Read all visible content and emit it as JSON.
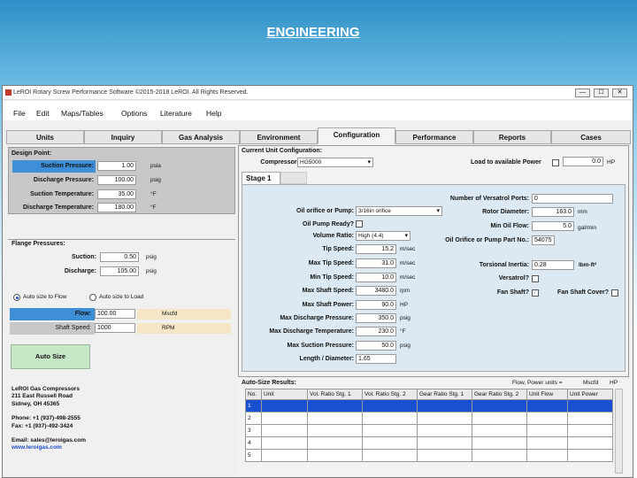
{
  "slide": {
    "title": "ENGINEERING"
  },
  "window": {
    "title": "LeROI Rotary Screw Performance Software ©2015-2018 LeROI. All Rights Reserved.",
    "minimize": "—",
    "maximize": "☐",
    "close": "✕"
  },
  "menu": [
    "File",
    "Edit",
    "Maps/Tables",
    "Options",
    "Literature",
    "Help"
  ],
  "tabs": [
    "Units",
    "Inquiry",
    "Gas Analysis",
    "Environment",
    "Configuration",
    "Performance",
    "Reports",
    "Cases"
  ],
  "active_tab": "Configuration",
  "design_point": {
    "title": "Design Point:",
    "rows": [
      {
        "label": "Suction Pressure:",
        "value": "1.00",
        "unit": "psia"
      },
      {
        "label": "Discharge Pressure:",
        "value": "100.00",
        "unit": "psig"
      },
      {
        "label": "Suction Temperature:",
        "value": "35.00",
        "unit": "°F"
      },
      {
        "label": "Discharge Temperature:",
        "value": "180.00",
        "unit": "°F"
      }
    ]
  },
  "flange": {
    "title": "Flange Pressures:",
    "rows": [
      {
        "label": "Suction:",
        "value": "0.50",
        "unit": "psig"
      },
      {
        "label": "Discharge:",
        "value": "105.00",
        "unit": "psig"
      }
    ]
  },
  "autosize": {
    "radio1": "Auto size to Flow",
    "radio2": "Auto size to Load",
    "flow_label": "Flow:",
    "flow_value": "100.00",
    "flow_unit": "Mscfd",
    "speed_label": "Shaft Speed:",
    "speed_value": "1000",
    "speed_unit": "RPM",
    "button": "Auto Size"
  },
  "company": {
    "lines": [
      "LeROI Gas Compressors",
      "211 East Russell Road",
      "Sidney, OH 45365",
      "",
      "Phone: +1 (937)-498-2555",
      "Fax: +1 (937)-492-3424",
      "",
      "Email: sales@leroigas.com",
      "www.leroigas.com"
    ]
  },
  "current_config": {
    "title": "Current Unit Configuration:",
    "compressor_label": "Compressor:",
    "compressor_value": "HG5000",
    "load_label": "Load to available Power",
    "power_value": "0.0",
    "power_unit": "HP"
  },
  "stage": {
    "tab": "Stage 1",
    "left": [
      {
        "label": "Oil orifice or Pump:",
        "value": "3/16in orifice",
        "type": "select"
      },
      {
        "label": "Oil Pump Ready?",
        "type": "check"
      },
      {
        "label": "Volume Ratio:",
        "value": "High (4.4)",
        "type": "select"
      },
      {
        "label": "Tip Speed:",
        "value": "15.2",
        "unit": "m/sec"
      },
      {
        "label": "Max Tip Speed:",
        "value": "31.0",
        "unit": "m/sec"
      },
      {
        "label": "Min Tip Speed:",
        "value": "10.0",
        "unit": "m/sec"
      },
      {
        "label": "Max Shaft Speed:",
        "value": "3480.0",
        "unit": "rpm"
      },
      {
        "label": "Max Shaft Power:",
        "value": "90.0",
        "unit": "HP"
      },
      {
        "label": "Max Discharge Pressure:",
        "value": "350.0",
        "unit": "psig"
      },
      {
        "label": "Max Discharge Temperature:",
        "value": "230.0",
        "unit": "°F"
      },
      {
        "label": "Max Suction Pressure:",
        "value": "50.0",
        "unit": "psig"
      },
      {
        "label": "Length / Diameter:",
        "value": "1.65",
        "unit": ""
      }
    ],
    "right": [
      {
        "label": "Number of Versatrol Ports:",
        "value": "0",
        "unit": ""
      },
      {
        "label": "Rotor Diameter:",
        "value": "163.0",
        "unit": "mm"
      },
      {
        "label": "Min Oil Flow:",
        "value": "5.0",
        "unit": "gal/min"
      },
      {
        "label": "Oil Orifice or Pump Part No.:",
        "value": "54075",
        "unit": ""
      },
      {
        "label": "Torsional Inertia:",
        "value": "0.28",
        "unit": "lbm-ft²"
      },
      {
        "label": "Versatrol?",
        "value": "",
        "unit": ""
      }
    ],
    "fan_shaft_label": "Fan Shaft?",
    "fan_cover_label": "Fan Shaft Cover?"
  },
  "results": {
    "title": "Auto-Size Results:",
    "units_note": "Flow, Power units =",
    "units_flow": "Mscfd",
    "units_power": "HP",
    "columns": [
      "No.",
      "Unit",
      "Vol. Ratio Stg. 1",
      "Vol. Ratio Stg. 2",
      "Gear Ratio Stg. 1",
      "Gear Ratio Stg. 2",
      "Unit Flow",
      "Unit Power"
    ],
    "rows": [
      "1",
      "2",
      "3",
      "4",
      "5"
    ]
  },
  "colors": {
    "accent_blue": "#1a4fd0",
    "design_bg": "#c8c8c8",
    "stage_bg": "#dce9f2",
    "autosize_green": "#c6e8c6"
  }
}
